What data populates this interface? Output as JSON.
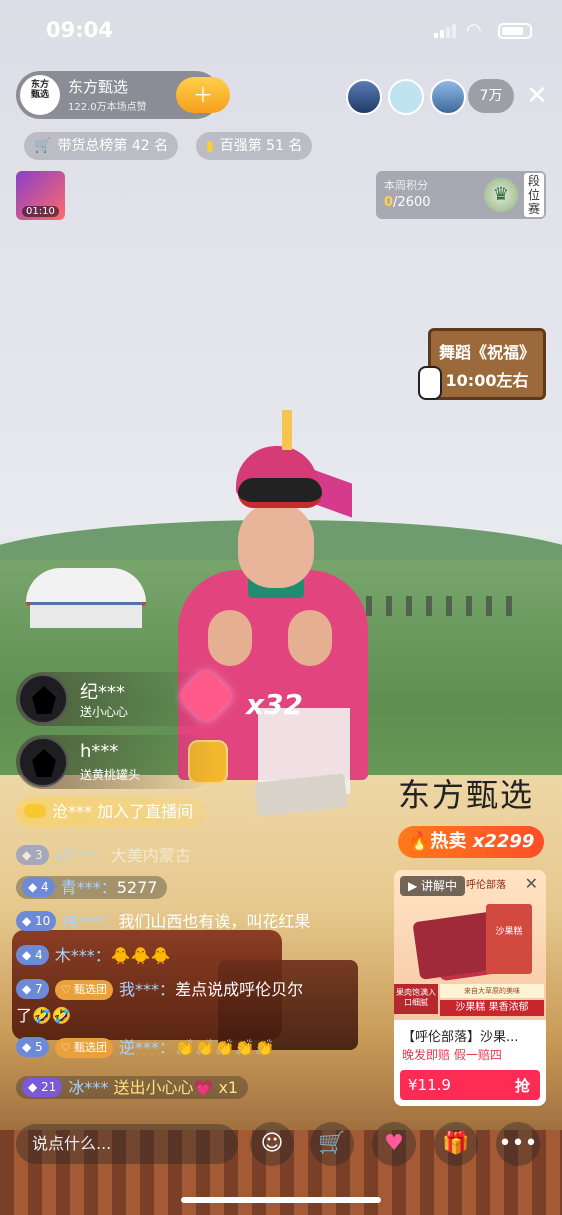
{
  "status_bar": {
    "time": "09:04"
  },
  "host": {
    "logo_text": "东方\n甄选",
    "name": "东方甄选",
    "likes": "122.0万本场点赞",
    "viewer_count": "7万"
  },
  "ranks": [
    {
      "label": "带货总榜第 42 名"
    },
    {
      "label": "百强第 51 名"
    }
  ],
  "thumbnail": {
    "time": "01:10"
  },
  "score": {
    "label": "本周积分",
    "value": "0",
    "total": "/2600",
    "segment": "段位赛"
  },
  "sign": {
    "line1": "舞蹈《祝福",
    "line1_end": "》",
    "line2": "10:00左右"
  },
  "gifts": [
    {
      "name": "纪***",
      "desc": "送小心心"
    },
    {
      "name": "h***",
      "desc": "送黄桃罐头"
    }
  ],
  "combo": "x32",
  "joined": {
    "text": "沧*** 加入了直播间"
  },
  "brand_watermark": "东方甄选",
  "hot_sale": {
    "label": "热卖",
    "count": "x2299"
  },
  "chat": [
    {
      "level": "3",
      "group": "",
      "user": "郭***：",
      "text": "大美内蒙古",
      "faded": true
    },
    {
      "level": "4",
      "group": "",
      "user": "青***：",
      "text": "5277",
      "faded": false
    },
    {
      "level": "10",
      "group": "",
      "user": "伟***：",
      "text": "我们山西也有诶，叫花红果",
      "faded": false
    },
    {
      "level": "4",
      "group": "",
      "user": "木***：",
      "text": "🐥🐥🐥",
      "faded": false
    },
    {
      "level": "7",
      "group": "甄选团",
      "user": "我***：",
      "text": "差点说成呼伦贝尔",
      "faded": false
    },
    {
      "level": "",
      "group": "",
      "user": "",
      "text": "了🤣🤣",
      "faded": false
    },
    {
      "level": "5",
      "group": "甄选团",
      "user": "逆***：",
      "text": "👏👏👏👏👏",
      "faded": false
    },
    {
      "level": "21",
      "group": "",
      "user": "冰***",
      "text": "送出小心心💗 x1",
      "faded": false
    }
  ],
  "product": {
    "live_tag": "讲解中",
    "brand_tag": "呼伦部落",
    "box_text": "沙果糕",
    "badge1": "果肉饱满入口细腻",
    "badge2": "来自大草原的美味",
    "badge3": "沙果糕 果香浓郁",
    "title": "【呼伦部落】沙果...",
    "promo": "晚发即赔  假一赔四",
    "price": "¥11.9",
    "buy_label": "抢"
  },
  "bottom_bar": {
    "input_placeholder": "说点什么..."
  },
  "colors": {
    "accent": "#fe2c55",
    "gold": "#ffcf2f",
    "hot": "#ff5a28"
  }
}
